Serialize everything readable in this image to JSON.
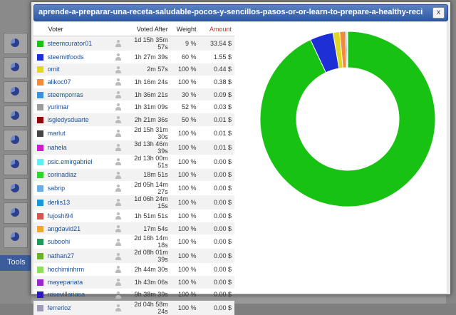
{
  "dialog": {
    "title": "aprende-a-preparar-una-receta-saludable-pocos-y-sencillos-pasos-or-or-learn-to-prepare-a-healthy-recipe-few-and-e...",
    "close_label": "x"
  },
  "background": {
    "tools_label": "Tools"
  },
  "table": {
    "headers": {
      "voter": "Voter",
      "voted_after": "Voted After",
      "weight": "Weight",
      "amount": "Amount"
    },
    "rows": [
      {
        "voter": "steemcurator01",
        "voted_after": "1d 15h 35m 57s",
        "weight": "9 %",
        "amount": "33.54 $",
        "color": "#18c213"
      },
      {
        "voter": "steemitfoods",
        "voted_after": "1h 27m 39s",
        "weight": "60 %",
        "amount": "1.55 $",
        "color": "#1f2fd6"
      },
      {
        "voter": "omit",
        "voted_after": "2m 57s",
        "weight": "100 %",
        "amount": "0.44 $",
        "color": "#e0d726"
      },
      {
        "voter": "alikoc07",
        "voted_after": "1h 16m 24s",
        "weight": "100 %",
        "amount": "0.38 $",
        "color": "#f28a3c"
      },
      {
        "voter": "steemporras",
        "voted_after": "1h 36m 21s",
        "weight": "30 %",
        "amount": "0.09 $",
        "color": "#3d8fe0"
      },
      {
        "voter": "yurimar",
        "voted_after": "1h 31m 09s",
        "weight": "52 %",
        "amount": "0.03 $",
        "color": "#9b9b9b"
      },
      {
        "voter": "isgledysduarte",
        "voted_after": "2h 21m 36s",
        "weight": "50 %",
        "amount": "0.01 $",
        "color": "#8b0a0a"
      },
      {
        "voter": "marlut",
        "voted_after": "2d 15h 31m 30s",
        "weight": "100 %",
        "amount": "0.01 $",
        "color": "#444444"
      },
      {
        "voter": "nahela",
        "voted_after": "3d 13h 46m 39s",
        "weight": "100 %",
        "amount": "0.01 $",
        "color": "#d21ad2"
      },
      {
        "voter": "psic.emirgabriel",
        "voted_after": "2d 13h 00m 51s",
        "weight": "100 %",
        "amount": "0.00 $",
        "color": "#5cf0f0"
      },
      {
        "voter": "corinadiaz",
        "voted_after": "18m 51s",
        "weight": "100 %",
        "amount": "0.00 $",
        "color": "#2bd62b"
      },
      {
        "voter": "sabrip",
        "voted_after": "2d 05h 14m 27s",
        "weight": "100 %",
        "amount": "0.00 $",
        "color": "#6aaee8"
      },
      {
        "voter": "derlis13",
        "voted_after": "1d 06h 24m 15s",
        "weight": "100 %",
        "amount": "0.00 $",
        "color": "#1797d6"
      },
      {
        "voter": "fujoshi94",
        "voted_after": "1h 51m 51s",
        "weight": "100 %",
        "amount": "0.00 $",
        "color": "#e05050"
      },
      {
        "voter": "angdavid21",
        "voted_after": "17m 54s",
        "weight": "100 %",
        "amount": "0.00 $",
        "color": "#f0a830"
      },
      {
        "voter": "suboohi",
        "voted_after": "2d 16h 14m 18s",
        "weight": "100 %",
        "amount": "0.00 $",
        "color": "#1f9a5a"
      },
      {
        "voter": "nathan27",
        "voted_after": "2d 08h 01m 39s",
        "weight": "100 %",
        "amount": "0.00 $",
        "color": "#6ab02a"
      },
      {
        "voter": "hochiminhrm",
        "voted_after": "2h 44m 30s",
        "weight": "100 %",
        "amount": "0.00 $",
        "color": "#8ee05a"
      },
      {
        "voter": "mayepariata",
        "voted_after": "1h 43m 06s",
        "weight": "100 %",
        "amount": "0.00 $",
        "color": "#9a28c8"
      },
      {
        "voter": "rosevillariasa",
        "voted_after": "9h 38m 39s",
        "weight": "100 %",
        "amount": "0.00 $",
        "color": "#2a18b8"
      },
      {
        "voter": "ferrerloz",
        "voted_after": "2d 04h 58m 24s",
        "weight": "100 %",
        "amount": "0.00 $",
        "color": "#a09ab8"
      }
    ]
  },
  "chart_data": {
    "type": "pie",
    "donut": true,
    "labels": [
      "steemcurator01",
      "steemitfoods",
      "omit",
      "alikoc07",
      "steemporras",
      "yurimar",
      "isgledysduarte",
      "marlut",
      "nahela"
    ],
    "values": [
      33.54,
      1.55,
      0.44,
      0.38,
      0.09,
      0.03,
      0.01,
      0.01,
      0.01
    ],
    "colors": [
      "#18c213",
      "#1f2fd6",
      "#e0d726",
      "#f28a3c",
      "#3d8fe0",
      "#9b9b9b",
      "#8b0a0a",
      "#444444",
      "#d21ad2"
    ]
  }
}
